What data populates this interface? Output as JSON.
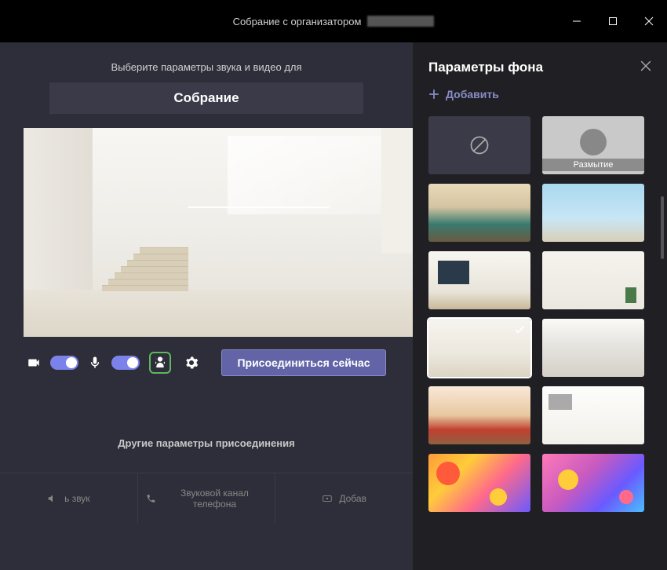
{
  "titlebar": {
    "prefix": "Собрание с организатором"
  },
  "left": {
    "instruction": "Выберите параметры звука и видео для",
    "meeting_title": "Собрание",
    "join_label": "Присоединиться сейчас",
    "other_options_label": "Другие параметры присоединения",
    "bottom": {
      "opt1": "ь звук",
      "opt2": "Звуковой канал телефона",
      "opt3": "Добав"
    }
  },
  "right": {
    "title": "Параметры фона",
    "add_label": "Добавить",
    "blur_label": "Размытие"
  }
}
